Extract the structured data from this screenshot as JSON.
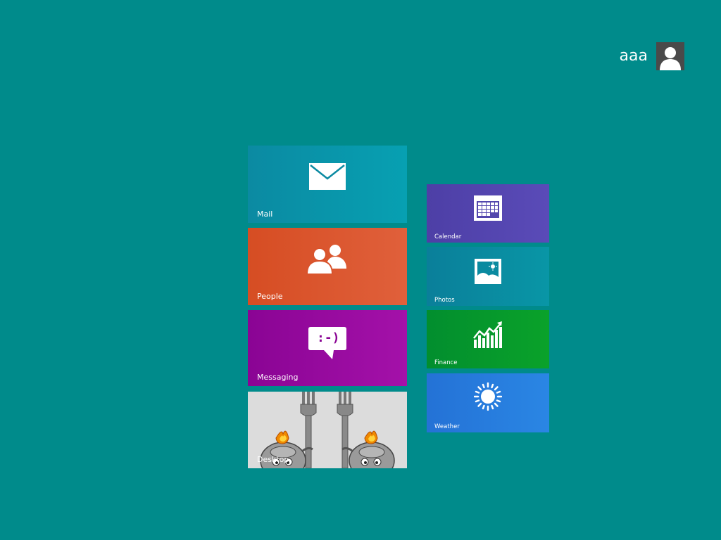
{
  "user": {
    "name": "aaa",
    "avatar_icon": "user-silhouette-icon"
  },
  "tiles": {
    "mail": {
      "label": "Mail",
      "icon": "envelope-icon",
      "color": "#0b8aa2"
    },
    "people": {
      "label": "People",
      "icon": "people-icon",
      "color": "#d64d23"
    },
    "messaging": {
      "label": "Messaging",
      "icon": "chat-bubble-icon",
      "icon_text": ":-)",
      "color": "#8a0494"
    },
    "desktop": {
      "label": "Desktop",
      "icon": "desktop-wallpaper-image",
      "color": "#dcdcdc"
    },
    "calendar": {
      "label": "Calendar",
      "icon": "calendar-icon",
      "color": "#4d3fa6"
    },
    "photos": {
      "label": "Photos",
      "icon": "photo-icon",
      "color": "#0a7f9a"
    },
    "finance": {
      "label": "Finance",
      "icon": "chart-up-icon",
      "color": "#028e2e"
    },
    "weather": {
      "label": "Weather",
      "icon": "sun-icon",
      "color": "#2472d6"
    }
  },
  "background_color": "#008b8b"
}
